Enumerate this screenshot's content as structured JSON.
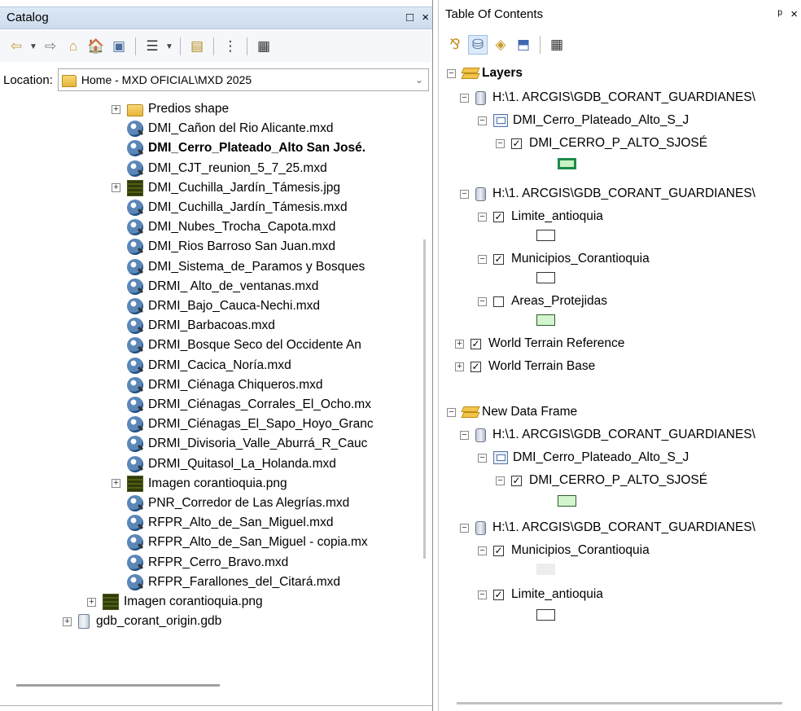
{
  "catalog": {
    "title": "Catalog",
    "title_buttons": [
      "□",
      "×"
    ],
    "toolbar_icons": [
      "back-icon",
      "forward-icon",
      "up-one-level-icon",
      "home-icon",
      "connect-folder-icon",
      "view-options-icon",
      "new-item-icon",
      "tree-toggle-icon",
      "details-icon"
    ],
    "location_label": "Location:",
    "location_value": "Home - MXD OFICIAL\\MXD 2025",
    "items": [
      {
        "label": "Predios shape",
        "icon": "folder",
        "expand": "+"
      },
      {
        "label": "DMI_Cañon del Rio Alicante.mxd",
        "icon": "mxd"
      },
      {
        "label": "DMI_Cerro_Plateado_Alto San José.",
        "icon": "mxd",
        "bold": true
      },
      {
        "label": "DMI_CJT_reunion_5_7_25.mxd",
        "icon": "mxd"
      },
      {
        "label": "DMI_Cuchilla_Jardín_Támesis.jpg",
        "icon": "raster",
        "expand": "+"
      },
      {
        "label": "DMI_Cuchilla_Jardín_Támesis.mxd",
        "icon": "mxd"
      },
      {
        "label": "DMI_Nubes_Trocha_Capota.mxd",
        "icon": "mxd"
      },
      {
        "label": "DMI_Rios Barroso San Juan.mxd",
        "icon": "mxd"
      },
      {
        "label": "DMI_Sistema_de_Paramos y Bosques",
        "icon": "mxd"
      },
      {
        "label": "DRMI_ Alto_de_ventanas.mxd",
        "icon": "mxd"
      },
      {
        "label": "DRMI_Bajo_Cauca-Nechi.mxd",
        "icon": "mxd"
      },
      {
        "label": "DRMI_Barbacoas.mxd",
        "icon": "mxd"
      },
      {
        "label": "DRMI_Bosque Seco del Occidente An",
        "icon": "mxd"
      },
      {
        "label": "DRMI_Cacica_Noría.mxd",
        "icon": "mxd"
      },
      {
        "label": "DRMI_Ciénaga Chiqueros.mxd",
        "icon": "mxd"
      },
      {
        "label": "DRMI_Ciénagas_Corrales_El_Ocho.mx",
        "icon": "mxd"
      },
      {
        "label": "DRMI_Ciénagas_El_Sapo_Hoyo_Granc",
        "icon": "mxd"
      },
      {
        "label": "DRMI_Divisoria_Valle_Aburrá_R_Cauc",
        "icon": "mxd"
      },
      {
        "label": "DRMI_Quitasol_La_Holanda.mxd",
        "icon": "mxd"
      },
      {
        "label": "Imagen corantioquia.png",
        "icon": "raster",
        "expand": "+"
      },
      {
        "label": "PNR_Corredor de Las Alegrías.mxd",
        "icon": "mxd"
      },
      {
        "label": "RFPR_Alto_de_San_Miguel.mxd",
        "icon": "mxd"
      },
      {
        "label": "RFPR_Alto_de_San_Miguel - copia.mx",
        "icon": "mxd"
      },
      {
        "label": "RFPR_Cerro_Bravo.mxd",
        "icon": "mxd"
      },
      {
        "label": "RFPR_Farallones_del_Citará.mxd",
        "icon": "mxd"
      },
      {
        "label": "Imagen corantioquia.png",
        "icon": "raster",
        "expand": "+"
      },
      {
        "label": "gdb_corant_origin.gdb",
        "icon": "gdb",
        "expand": "+"
      }
    ]
  },
  "toc": {
    "title": "Table Of Contents",
    "title_buttons": [
      "ᵖ",
      "×"
    ],
    "toolbar_icons": [
      "list-by-drawing-order-icon",
      "list-by-source-icon",
      "list-by-visibility-icon",
      "list-by-selection-icon",
      "options-icon"
    ],
    "nodes": [
      {
        "label": "Layers",
        "type": "dataframe",
        "expand": "−",
        "bold": true
      },
      {
        "label": "H:\\1. ARCGIS\\GDB_CORANT_GUARDIANES\\",
        "type": "workspace",
        "expand": "−"
      },
      {
        "label": "DMI_Cerro_Plateado_Alto_S_J",
        "type": "group",
        "expand": "−"
      },
      {
        "label": "DMI_CERRO_P_ALTO_SJOSÉ",
        "type": "layer",
        "expand": "−",
        "checked": true,
        "symbol": "greenbold"
      },
      {
        "label": "H:\\1. ARCGIS\\GDB_CORANT_GUARDIANES\\",
        "type": "workspace",
        "expand": "−"
      },
      {
        "label": "Limite_antioquia",
        "type": "layer",
        "expand": "−",
        "checked": true,
        "symbol": "white"
      },
      {
        "label": "Municipios_Corantioquia",
        "type": "layer",
        "expand": "−",
        "checked": true,
        "symbol": "white"
      },
      {
        "label": "Areas_Protejidas",
        "type": "layer",
        "expand": "−",
        "checked": false,
        "symbol": "green"
      },
      {
        "label": "World Terrain Reference",
        "type": "layer",
        "expand": "+",
        "checked": true
      },
      {
        "label": "World Terrain Base",
        "type": "layer",
        "expand": "+",
        "checked": true
      },
      {
        "label": "New Data Frame",
        "type": "dataframe",
        "expand": "−"
      },
      {
        "label": "H:\\1. ARCGIS\\GDB_CORANT_GUARDIANES\\",
        "type": "workspace",
        "expand": "−"
      },
      {
        "label": "DMI_Cerro_Plateado_Alto_S_J",
        "type": "group",
        "expand": "−"
      },
      {
        "label": "DMI_CERRO_P_ALTO_SJOSÉ",
        "type": "layer",
        "expand": "−",
        "checked": true,
        "symbol": "green"
      },
      {
        "label": "H:\\1. ARCGIS\\GDB_CORANT_GUARDIANES\\",
        "type": "workspace",
        "expand": "−"
      },
      {
        "label": "Municipios_Corantioquia",
        "type": "layer",
        "expand": "−",
        "checked": true,
        "symbol": "gray"
      },
      {
        "label": "Limite_antioquia",
        "type": "layer",
        "expand": "−",
        "checked": true,
        "symbol": "white"
      }
    ]
  },
  "colors": {
    "title_bar": "#cddced",
    "symbol_green": "#d3f5cd",
    "symbol_green_outline": "#1d8a4b"
  }
}
